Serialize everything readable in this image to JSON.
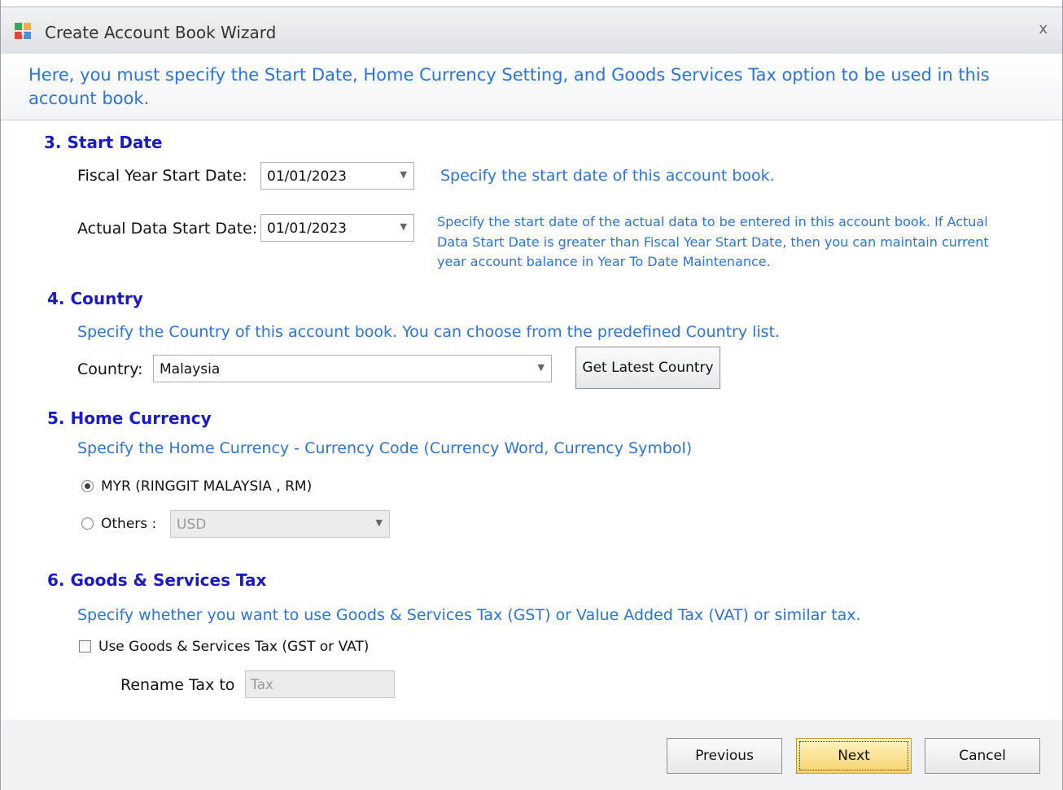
{
  "window": {
    "title": "Create Account Book Wizard",
    "close_glyph": "x"
  },
  "banner": {
    "text": "Here, you must specify the Start Date, Home Currency Setting, and Goods  Services Tax option to be used in this account book."
  },
  "start_date": {
    "title": "3. Start Date",
    "fiscal_label": "Fiscal Year Start Date:",
    "fiscal_value": "01/01/2023",
    "fiscal_hint": "Specify the start date of this account book.",
    "actual_label": "Actual Data Start Date:",
    "actual_value": "01/01/2023",
    "actual_hint_1": "Specify the start date of the actual data to be entered in this account book. If Actual",
    "actual_hint_2": "Data Start Date is greater than Fiscal Year Start Date, then you can maintain current",
    "actual_hint_3": "year account balance in Year To Date Maintenance."
  },
  "country": {
    "title": "4. Country",
    "hint": "Specify the Country of this account book. You can choose from the predefined Country list.",
    "label": "Country:",
    "value": "Malaysia",
    "get_latest_label": "Get Latest Country"
  },
  "currency": {
    "title": "5. Home Currency",
    "hint": "Specify the Home Currency - Currency Code (Currency Word, Currency Symbol)",
    "home_option": "MYR (RINGGIT MALAYSIA , RM)",
    "home_selected": true,
    "others_label": "Others :",
    "others_value": "USD"
  },
  "gst": {
    "title": "6. Goods & Services Tax",
    "hint": "Specify whether you want to use Goods & Services Tax (GST) or Value Added Tax (VAT) or similar tax.",
    "use_label": "Use Goods & Services Tax (GST or VAT)",
    "use_checked": false,
    "rename_label": "Rename Tax to",
    "rename_value": "Tax"
  },
  "footer": {
    "previous_label": "Previous",
    "next_label": "Next",
    "cancel_label": "Cancel"
  },
  "icons": {
    "app": "account-book-app-icon",
    "dropdown": "chevron-down-icon"
  },
  "colors": {
    "accent_text": "#2a73e0",
    "section_title": "#1a1acb",
    "primary_button": "#f6d36a"
  }
}
